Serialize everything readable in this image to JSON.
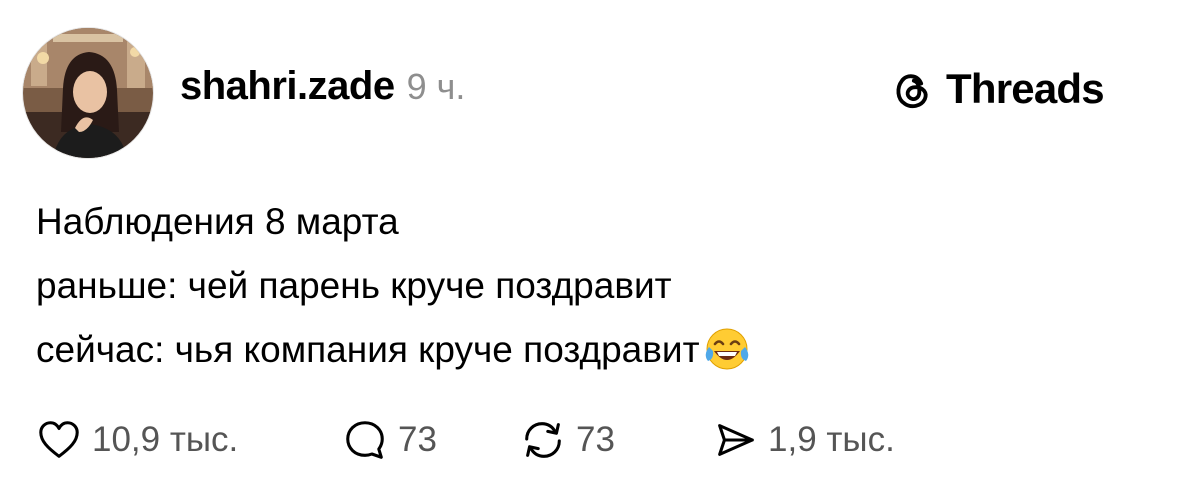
{
  "post": {
    "author": {
      "username": "shahri.zade",
      "time_ago": "9 ч."
    },
    "brand": {
      "name": "Threads",
      "icon": "threads-logo-icon"
    },
    "lines": [
      "Наблюдения 8 марта",
      "раньше: чей парень круче поздравит",
      "сейчас: чья компания круче поздравит"
    ],
    "emoji": "tears-of-joy-emoji",
    "actions": {
      "like": {
        "icon": "heart-icon",
        "count": "10,9 тыс."
      },
      "reply": {
        "icon": "comment-bubble-icon",
        "count": "73"
      },
      "repost": {
        "icon": "repost-icon",
        "count": "73"
      },
      "share": {
        "icon": "send-icon",
        "count": "1,9 тыс."
      }
    }
  },
  "colors": {
    "text": "#000000",
    "muted": "#8e8e8e",
    "counts": "#555555",
    "background": "#ffffff"
  }
}
